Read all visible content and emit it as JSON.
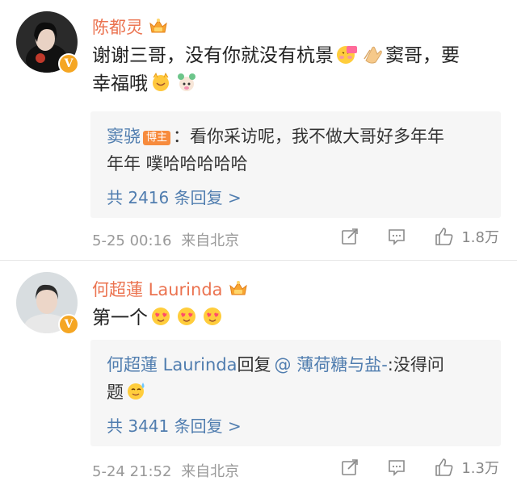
{
  "comments": [
    {
      "username": "陈都灵",
      "text_part1": "谢谢三哥，没有你就没有杭景",
      "text_part2": "窦哥，要",
      "text_line2": "幸福哦",
      "reply": {
        "author": "窦骁",
        "author_badge": "博主",
        "text_line1": "：看你采访呢，我不做大哥好多年年",
        "text_line2": "年年 噗哈哈哈哈哈"
      },
      "more_replies": "共 2416 条回复 >",
      "timestamp": "5-25 00:16",
      "source": "来自北京",
      "like_count": "1.8万"
    },
    {
      "username": "何超蓮 Laurinda",
      "text": "第一个",
      "reply": {
        "author": "何超蓮 Laurinda",
        "reply_word": "回复",
        "mention": "@ 薄荷糖与盐-",
        "text_line1_rest": ":没得问",
        "text_line2": "题"
      },
      "more_replies": "共 3441 条回复 >",
      "timestamp": "5-24 21:52",
      "source": "来自北京",
      "like_count": "1.3万"
    }
  ],
  "colors": {
    "username": "#eb7350",
    "link": "#507daf",
    "meta": "#999999",
    "reply_bg": "#f6f6f6",
    "verified_badge": "#f5a623"
  },
  "icons": [
    "verified-v-icon",
    "vip-crown-icon",
    "repost-icon",
    "comment-icon",
    "like-icon"
  ]
}
